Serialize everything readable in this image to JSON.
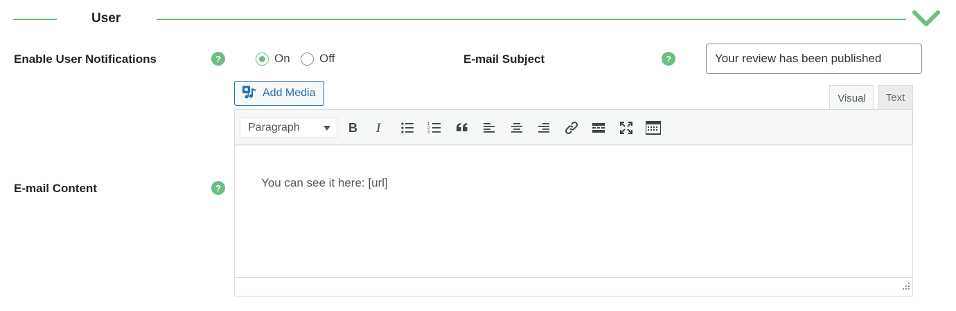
{
  "section": {
    "title": "User"
  },
  "colors": {
    "accent": "#6cbf84",
    "link": "#2271b1"
  },
  "notifications": {
    "label": "Enable User Notifications",
    "options": [
      {
        "label": "On",
        "checked": true
      },
      {
        "label": "Off",
        "checked": false
      }
    ]
  },
  "subject": {
    "label": "E-mail Subject",
    "value": "Your review has been published"
  },
  "content": {
    "label": "E-mail Content",
    "add_media_label": "Add Media",
    "tabs": [
      {
        "label": "Visual",
        "active": true
      },
      {
        "label": "Text",
        "active": false
      }
    ],
    "format_select": "Paragraph",
    "toolbar_icons": [
      "bold-icon",
      "italic-icon",
      "bullet-list-icon",
      "numbered-list-icon",
      "blockquote-icon",
      "align-left-icon",
      "align-center-icon",
      "align-right-icon",
      "link-icon",
      "read-more-icon",
      "fullscreen-icon",
      "toolbar-toggle-icon"
    ],
    "body_text": "You can see it here: [url]"
  },
  "help_glyph": "?"
}
